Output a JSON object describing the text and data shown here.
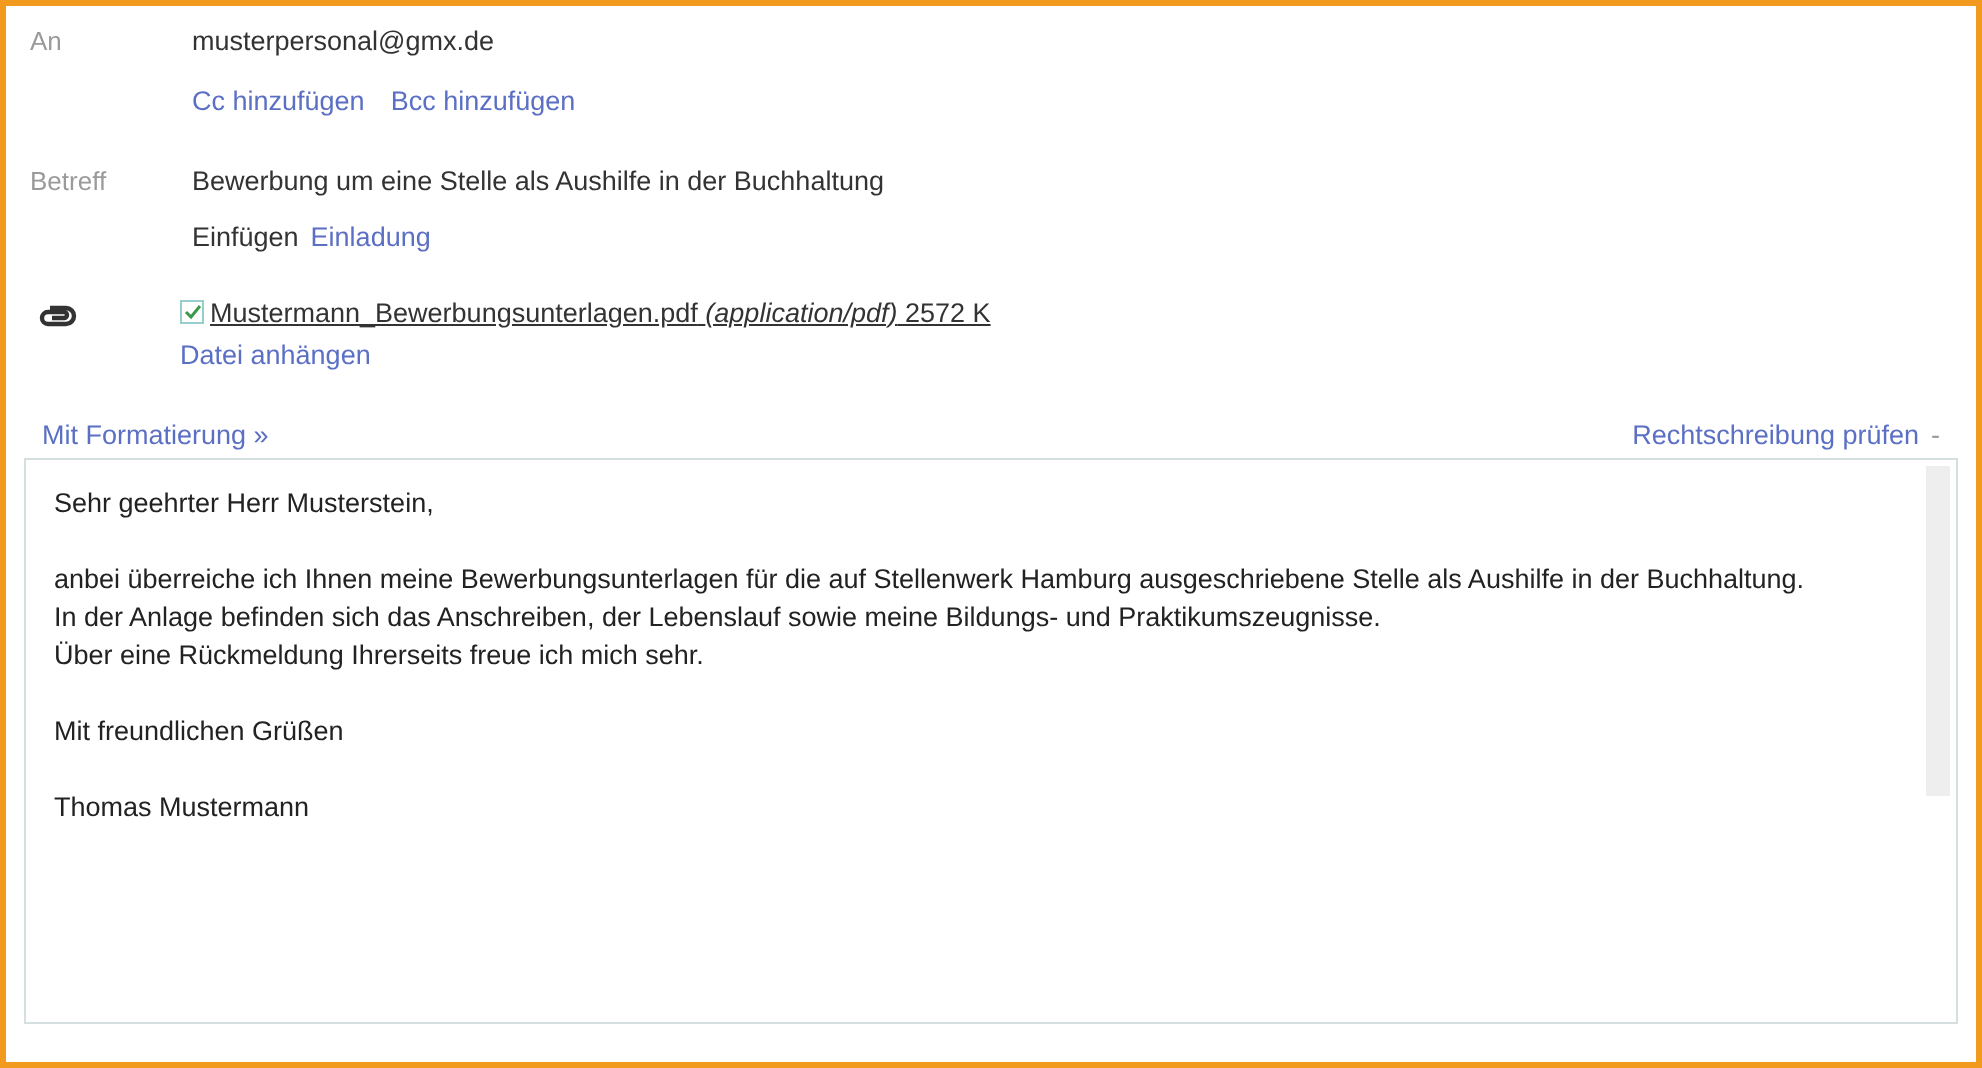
{
  "recipient": {
    "label": "An",
    "value": "musterpersonal@gmx.de"
  },
  "copy_links": [
    "Cc hinzufügen",
    "Bcc hinzufügen"
  ],
  "subject": {
    "label": "Betreff",
    "value": "Bewerbung um eine Stelle als Aushilfe in der Buchhaltung"
  },
  "insert": {
    "label": "Einfügen",
    "link": "Einladung"
  },
  "attachment": {
    "checked": true,
    "name": "Mustermann_Bewerbungsunterlagen.pdf",
    "type": "(application/pdf)",
    "size": "2572 K"
  },
  "attach_link": "Datei anhängen",
  "format_link": "Mit Formatierung »",
  "spellcheck": {
    "label": "Rechtschreibung prüfen",
    "caret": "-"
  },
  "body": [
    [
      "Sehr geehrter Herr Musterstein,"
    ],
    [
      "anbei überreiche ich Ihnen meine Bewerbungsunterlagen für die auf Stellenwerk Hamburg ausgeschriebene Stelle  als Aushilfe in der Buchhaltung.",
      "In der Anlage befinden sich das Anschreiben, der Lebenslauf sowie meine Bildungs- und Praktikumszeugnisse.",
      "Über eine Rückmeldung Ihrerseits freue ich mich sehr."
    ],
    [
      "Mit freundlichen Grüßen"
    ],
    [
      "Thomas Mustermann"
    ]
  ]
}
